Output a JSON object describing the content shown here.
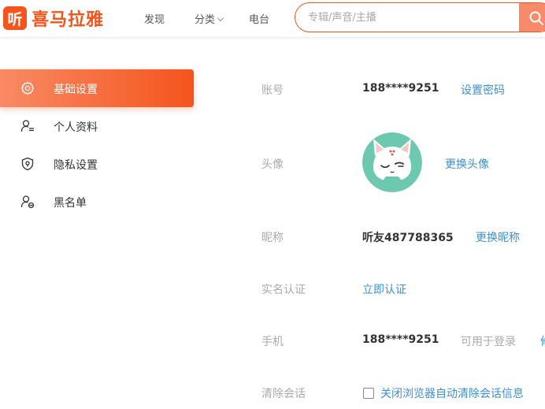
{
  "header": {
    "logo_badge": "听",
    "logo_text": "喜马拉雅",
    "nav": {
      "discover": "发现",
      "category": "分类",
      "radio": "电台"
    },
    "search": {
      "placeholder": "专辑/声音/主播",
      "value": ""
    },
    "accent_color": "#f5541c"
  },
  "sidebar": {
    "items": [
      {
        "label": "基础设置",
        "icon": "gear-icon",
        "active": true
      },
      {
        "label": "个人资料",
        "icon": "user-profile-icon",
        "active": false
      },
      {
        "label": "隐私设置",
        "icon": "shield-icon",
        "active": false
      },
      {
        "label": "黑名单",
        "icon": "user-block-icon",
        "active": false
      }
    ]
  },
  "form": {
    "account": {
      "label": "账号",
      "value": "188****9251",
      "action": "设置密码"
    },
    "avatar": {
      "label": "头像",
      "action": "更换头像",
      "image": "cat-avatar"
    },
    "nickname": {
      "label": "昵称",
      "value": "听友487788365",
      "action": "更换昵称"
    },
    "realname": {
      "label": "实名认证",
      "action": "立即认证"
    },
    "phone": {
      "label": "手机",
      "value": "188****9251",
      "note": "可用于登录",
      "action_fragment": "修"
    },
    "clear_session": {
      "label": "清除会话",
      "checkbox_label": "关闭浏览器自动清除会话信息",
      "checked": false
    }
  },
  "colors": {
    "link": "#3d8fd9",
    "label": "#aaaaaa",
    "text": "#333333"
  }
}
